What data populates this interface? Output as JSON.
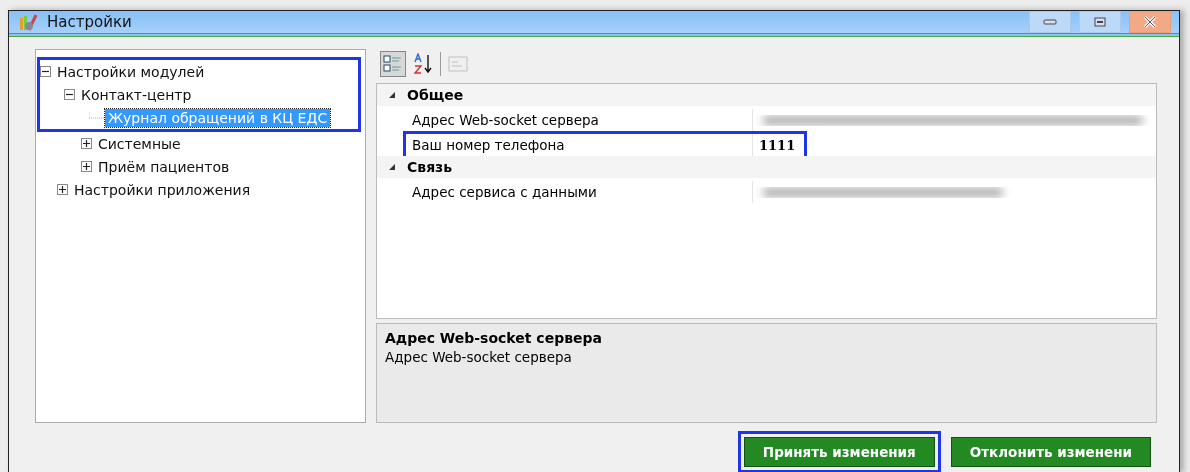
{
  "window": {
    "title": "Настройки"
  },
  "tree": [
    {
      "label": "Настройки модулей",
      "expanded": true,
      "selected": false,
      "highlighted": true,
      "children": [
        {
          "label": "Контакт-центр",
          "expanded": true,
          "selected": false,
          "highlighted": true,
          "children": [
            {
              "label": "Журнал обращений в КЦ ЕДС",
              "selected": true,
              "highlighted": true
            }
          ]
        },
        {
          "label": "Системные",
          "expanded": false,
          "selected": false,
          "highlighted": false
        },
        {
          "label": "Приём пациентов",
          "expanded": false,
          "selected": false,
          "highlighted": false
        }
      ]
    },
    {
      "label": "Настройки приложения",
      "expanded": false,
      "selected": false,
      "highlighted": false
    }
  ],
  "toolbar": [
    {
      "kind": "categorized",
      "selected": true,
      "disabled": false
    },
    {
      "kind": "alphabetical",
      "selected": false,
      "disabled": false
    },
    {
      "kind": "pages",
      "selected": false,
      "disabled": true
    }
  ],
  "property_grid": [
    {
      "category": "Общее",
      "expanded": true,
      "properties": [
        {
          "name": "Адрес Web-socket сервера",
          "redacted": true,
          "highlighted": false
        },
        {
          "name": "Ваш номер телефона",
          "value": "1111",
          "redacted": false,
          "highlighted": true
        }
      ]
    },
    {
      "category": "Связь",
      "expanded": true,
      "properties": [
        {
          "name": "Адрес сервиса с данными",
          "redacted": true,
          "highlighted": false
        }
      ]
    }
  ],
  "description": {
    "title": "Адрес Web-socket сервера",
    "text": "Адрес Web-socket сервера"
  },
  "buttons": [
    {
      "label": "Принять изменения",
      "highlighted": true
    },
    {
      "label": "Отклонить изменени",
      "highlighted": false
    }
  ]
}
